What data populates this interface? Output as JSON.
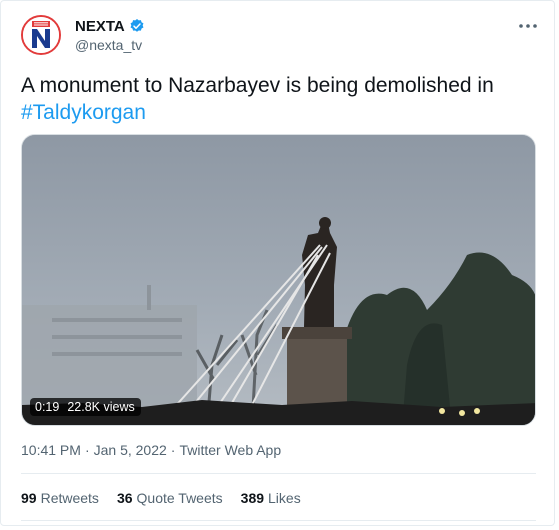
{
  "account": {
    "display_name": "NEXTA",
    "handle": "@nexta_tv",
    "verified": true
  },
  "tweet": {
    "text_prefix": "A monument to Nazarbayev is being demolished in",
    "hashtag": "#Taldykorgan"
  },
  "media": {
    "video_time": "0:19",
    "views": "22.8K views"
  },
  "meta": {
    "time": "10:41 PM",
    "separator": "·",
    "date": "Jan 5, 2022",
    "app": "Twitter Web App"
  },
  "stats": {
    "retweets_count": "99",
    "retweets_label": "Retweets",
    "quotes_count": "36",
    "quotes_label": "Quote Tweets",
    "likes_count": "389",
    "likes_label": "Likes"
  },
  "colors": {
    "accent": "#1d9bf0",
    "brand": "#e23b3b",
    "text_primary": "#0f1419",
    "text_secondary": "#536471"
  }
}
